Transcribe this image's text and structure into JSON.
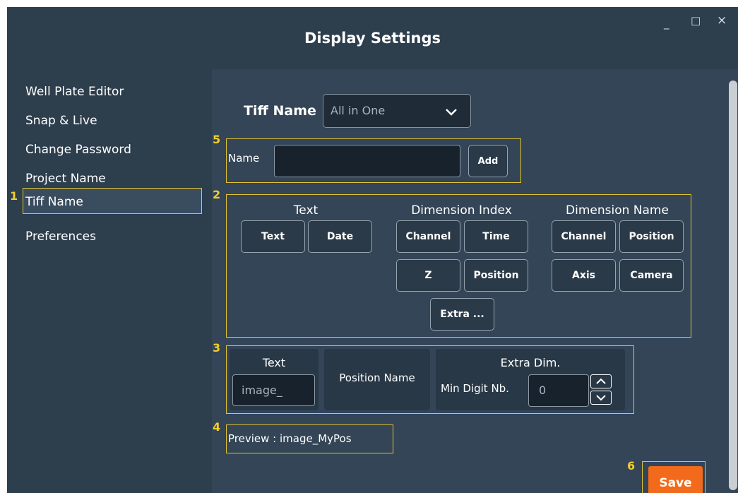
{
  "window": {
    "title": "Display Settings",
    "controls": {
      "minimize": "_",
      "maximize": "□",
      "close": "×"
    }
  },
  "sidebar": {
    "items": [
      {
        "label": "Well Plate Editor"
      },
      {
        "label": "Snap & Live"
      },
      {
        "label": "Change Password"
      },
      {
        "label": "Project Name"
      },
      {
        "label": "Tiff Name"
      },
      {
        "label": "Preferences"
      }
    ],
    "active_index": 4
  },
  "annotations": [
    "1",
    "2",
    "3",
    "4",
    "5",
    "6"
  ],
  "tiff_name": {
    "label": "Tiff Name",
    "selected": "All in One"
  },
  "name_row": {
    "label": "Name",
    "value": "",
    "add_label": "Add"
  },
  "groups": {
    "text": {
      "title": "Text",
      "buttons": [
        "Text",
        "Date"
      ]
    },
    "dimension_index": {
      "title": "Dimension Index",
      "buttons": [
        "Channel",
        "Time",
        "Z",
        "Position",
        "Extra ..."
      ]
    },
    "dimension_name": {
      "title": "Dimension Name",
      "buttons": [
        "Channel",
        "Position",
        "Axis",
        "Camera"
      ]
    }
  },
  "format": {
    "text_title": "Text",
    "text_value": "image_",
    "position_name": "Position Name",
    "extra_title": "Extra Dim.",
    "min_digit_label": "Min Digit Nb.",
    "min_digit_value": "0"
  },
  "preview": {
    "text": "Preview : image_MyPos"
  },
  "save_label": "Save",
  "colors": {
    "accent": "#f2cd2e",
    "save": "#f26a1b",
    "background": "#2d3e4d",
    "content": "#334556"
  }
}
